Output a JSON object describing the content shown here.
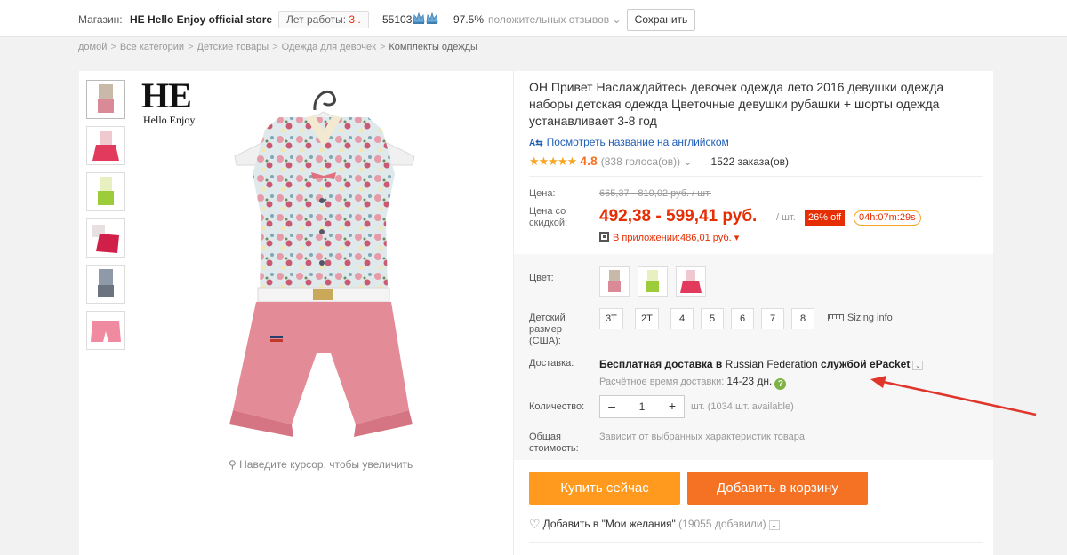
{
  "store_bar": {
    "label": "Магазин:",
    "name": "HE Hello Enjoy official store",
    "years_label": "Лет работы:",
    "years_value": "3 .",
    "score": "55103",
    "positive_pct": "97.5%",
    "feedback_label": "положительных отзывов",
    "save_button": "Сохранить"
  },
  "breadcrumbs": [
    "домой",
    "Все категории",
    "Детские товары",
    "Одежда для девочек",
    "Комплекты одежды"
  ],
  "gallery": {
    "brand_logo": "HE",
    "brand_sub": "Hello Enjoy",
    "zoom_hint": "Наведите курсор, чтобы увеличить",
    "thumbnails": [
      "pink-shorts-set",
      "red-skirt-set",
      "green-set",
      "red-dress-set",
      "gray-floral-set",
      "pink-shorts"
    ]
  },
  "product": {
    "title": "OH Привет Наслаждайтесь девочек одежда лето 2016 девушки одежда наборы детская одежда Цветочные девушки рубашки + шорты одежда устанавливает 3-8 год",
    "translate_link": "Посмотреть название на английском",
    "rating_value": "4.8",
    "votes": "(838 голоса(ов))",
    "orders": "1522 заказа(ов)",
    "price_label": "Цена:",
    "old_price": "665,37 - 810,02 руб. / шт.",
    "discount_label": "Цена со скидкой:",
    "discount_price": "492,38 - 599,41 руб.",
    "unit": "/ шт.",
    "off_badge": "26% off",
    "timer": "04h:07m:29s",
    "app_price": "В приложении:486,01 руб."
  },
  "options": {
    "color_label": "Цвет:",
    "size_label": "Детский размер (США):",
    "sizes": [
      "3T",
      "2T",
      "4",
      "5",
      "6",
      "7",
      "8"
    ],
    "sizing_info": "Sizing info",
    "shipping_label": "Доставка:",
    "shipping_prefix": "Бесплатная доставка в",
    "shipping_country": "Russian Federation",
    "shipping_suffix": "службой ePacket",
    "eta_label": "Расчётное время доставки:",
    "eta_days": "14-23 дн.",
    "qty_label": "Количество:",
    "qty_value": "1",
    "qty_unit": "шт. (1034 шт. available)",
    "total_label": "Общая стоимость:",
    "total_value": "Зависит от выбранных характеристик товара"
  },
  "actions": {
    "buy_now": "Купить сейчас",
    "add_to_cart": "Добавить в корзину",
    "wishlist": "Добавить в \"Мои желания\"",
    "wishlist_count": "(19055 добавили)"
  },
  "colors": {
    "price_red": "#e62e04",
    "buy_orange": "#ff9a1f",
    "cart_orange": "#f57224",
    "link_blue": "#1f5eb5",
    "star_gold": "#f5a623"
  }
}
